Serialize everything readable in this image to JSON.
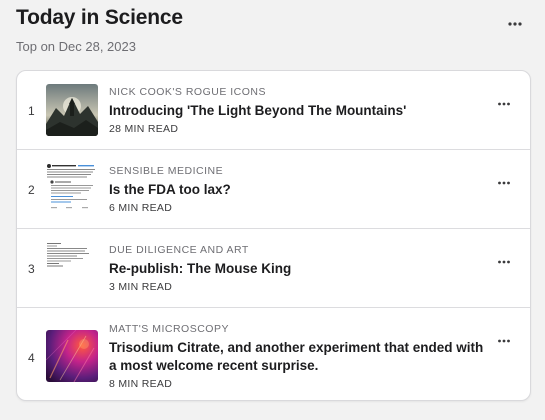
{
  "header": {
    "title": "Today in Science",
    "subtitle": "Top on Dec 28, 2023",
    "more_icon": "ellipsis-icon"
  },
  "articles": [
    {
      "rank": "1",
      "publisher": "NICK COOK'S ROGUE ICONS",
      "title": "Introducing 'The Light Beyond The Mountains'",
      "read_time": "28 MIN READ",
      "thumbnail": "mountain-landscape-image"
    },
    {
      "rank": "2",
      "publisher": "SENSIBLE MEDICINE",
      "title": "Is the FDA too lax?",
      "read_time": "6 MIN READ",
      "thumbnail": "tweet-screenshot-image"
    },
    {
      "rank": "3",
      "publisher": "DUE DILIGENCE AND ART",
      "title": "Re-publish: The Mouse King",
      "read_time": "3 MIN READ",
      "thumbnail": "document-text-image"
    },
    {
      "rank": "4",
      "publisher": "MATT'S MICROSCOPY",
      "title": "Trisodium Citrate, and another experiment that ended with a most welcome recent surprise.",
      "read_time": "8 MIN READ",
      "thumbnail": "micrograph-image"
    }
  ],
  "colors": {
    "background": "#f2f2f2",
    "card": "#ffffff",
    "secondary_text": "#6e6e73"
  }
}
